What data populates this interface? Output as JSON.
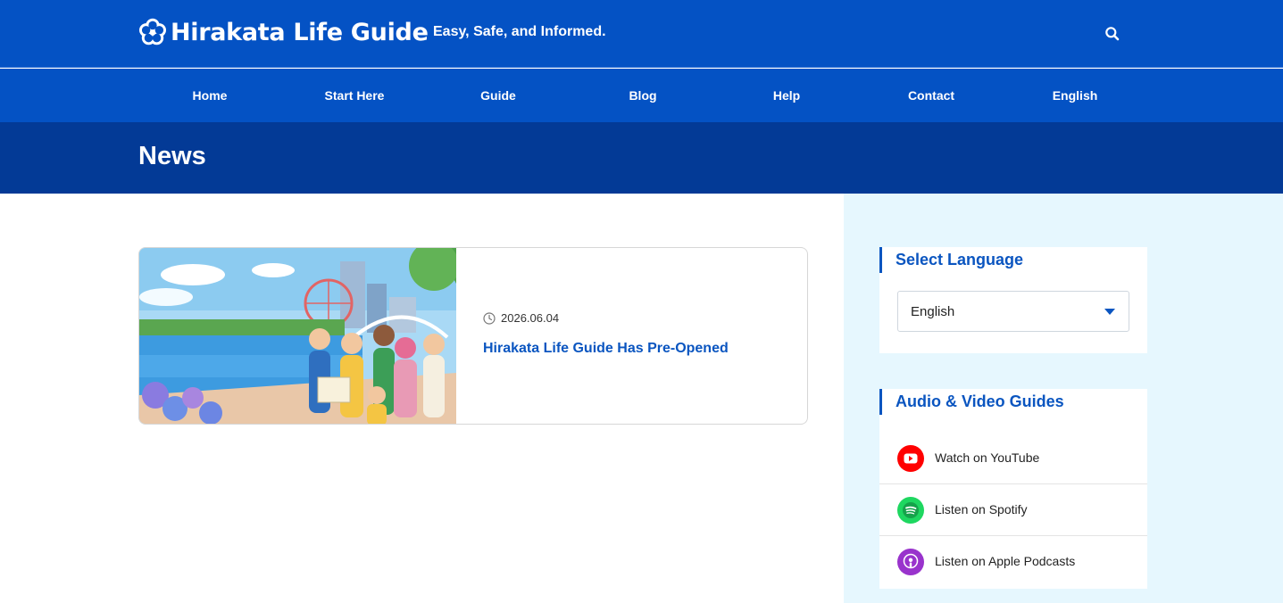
{
  "header": {
    "site_title": "Hirakata Life Guide",
    "tagline": "Easy, Safe, and Informed.",
    "logo_icon": "flower-icon",
    "search_icon": "search-icon",
    "brand_color": "#0452c4"
  },
  "nav": {
    "items": [
      {
        "label": "Home"
      },
      {
        "label": "Start Here"
      },
      {
        "label": "Guide"
      },
      {
        "label": "Blog"
      },
      {
        "label": "Help"
      },
      {
        "label": "Contact"
      },
      {
        "label": "English"
      }
    ]
  },
  "page": {
    "title": "News",
    "title_band_color": "#033a96"
  },
  "posts": [
    {
      "date": "2026.06.04",
      "title": "Hirakata Life Guide Has Pre-Opened",
      "thumbnail_icon": "riverside-illustration-image"
    }
  ],
  "sidebar": {
    "background_color": "#e6f7fe",
    "language_widget": {
      "title": "Select Language",
      "selected": "English"
    },
    "av_widget": {
      "title": "Audio & Video Guides",
      "items": [
        {
          "label": "Watch on YouTube",
          "icon": "youtube-icon",
          "color": "#ff0000"
        },
        {
          "label": "Listen on Spotify",
          "icon": "spotify-icon",
          "color": "#1ed760"
        },
        {
          "label": "Listen on Apple Podcasts",
          "icon": "apple-podcasts-icon",
          "color": "#9933cc"
        }
      ]
    }
  }
}
